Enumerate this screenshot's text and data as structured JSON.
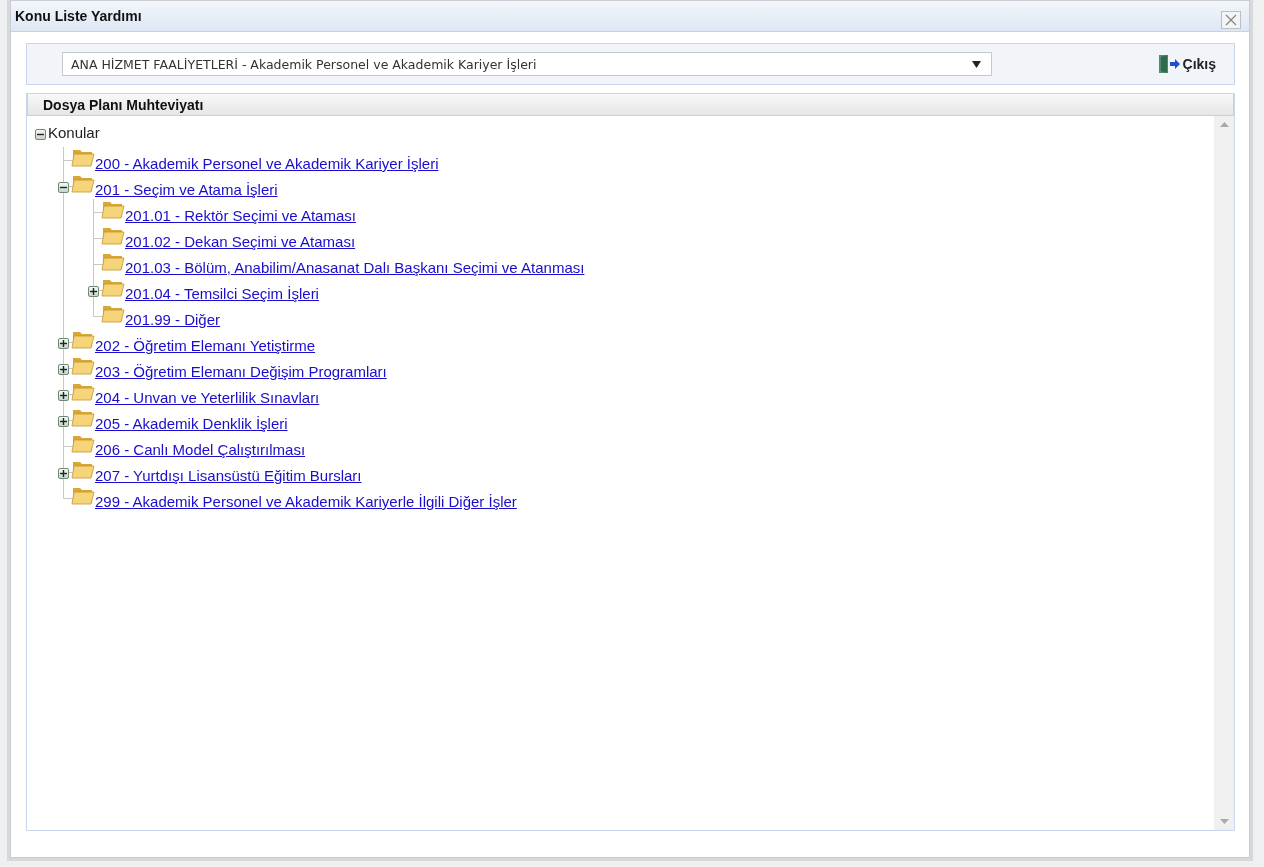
{
  "window": {
    "title": "Konu Liste Yardımı"
  },
  "toolbar": {
    "category_select": {
      "value": "ANA HİZMET FAALİYETLERİ - Akademik Personel ve Akademik Kariyer İşleri"
    },
    "exit_button": {
      "label": "Çıkış"
    }
  },
  "panel": {
    "title": "Dosya Planı Muhteviyatı"
  },
  "tree": {
    "label": "Konular",
    "expanded": true,
    "children": [
      {
        "label": "200 - Akademik Personel ve Akademik Kariyer İşleri"
      },
      {
        "label": "201 - Seçim ve Atama İşleri",
        "expanded": true,
        "children": [
          {
            "label": "201.01 - Rektör Seçimi ve Ataması"
          },
          {
            "label": "201.02 - Dekan Seçimi ve Ataması"
          },
          {
            "label": "201.03 - Bölüm, Anabilim/Anasanat Dalı Başkanı Seçimi ve Atanması"
          },
          {
            "label": "201.04 - Temsilci Seçim İşleri",
            "expanded": false
          },
          {
            "label": "201.99 - Diğer"
          }
        ]
      },
      {
        "label": "202 - Öğretim Elemanı Yetiştirme",
        "expanded": false
      },
      {
        "label": "203 - Öğretim Elemanı Değişim Programları",
        "expanded": false
      },
      {
        "label": "204 - Unvan ve Yeterlilik Sınavları",
        "expanded": false
      },
      {
        "label": "205 - Akademik Denklik İşleri",
        "expanded": false
      },
      {
        "label": "206 - Canlı Model Çalıştırılması"
      },
      {
        "label": "207 - Yurtdışı Lisansüstü Eğitim Bursları",
        "expanded": false
      },
      {
        "label": "299 - Akademik Personel ve Akademik Kariyerle İlgili Diğer İşler"
      }
    ]
  }
}
